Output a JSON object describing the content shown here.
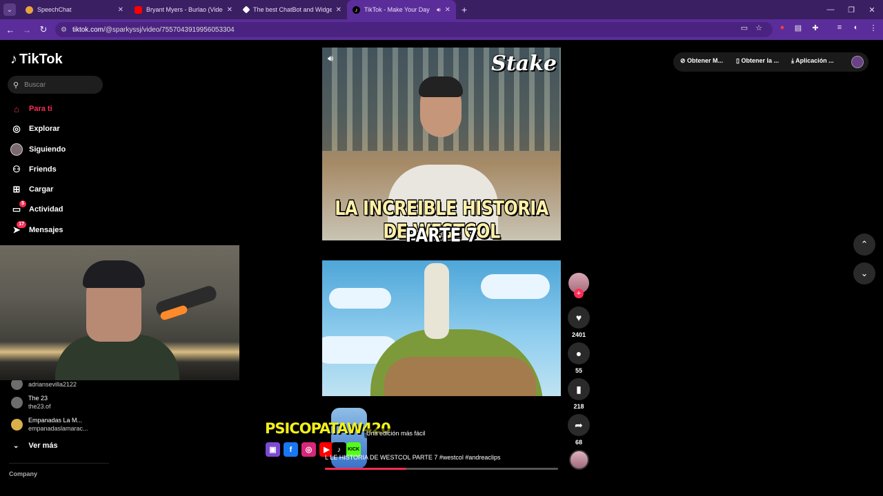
{
  "browser": {
    "tabs": [
      {
        "title": "SpeechChat",
        "icon": "speechchat-icon",
        "color": "#e8a33b"
      },
      {
        "title": "Bryant Myers - Burlao (Video Oficial)",
        "icon": "youtube-icon",
        "color": "#ff0000"
      },
      {
        "title": "The best ChatBot and Widgets",
        "icon": "streamelements-icon",
        "color": "#ffffff"
      },
      {
        "title": "TikTok - Make Your Day",
        "icon": "tiktok-icon",
        "color": "#000000"
      }
    ],
    "url_host": "tiktok.com",
    "url_path": "/@sparkyssj/video/7557043919956053304"
  },
  "sidebar": {
    "logo": "TikTok",
    "search_placeholder": "Buscar",
    "items": [
      {
        "label": "Para ti",
        "icon": "home-icon"
      },
      {
        "label": "Explorar",
        "icon": "compass-icon"
      },
      {
        "label": "Siguiendo",
        "icon": "following-avatar-icon"
      },
      {
        "label": "Friends",
        "icon": "friends-icon"
      },
      {
        "label": "Cargar",
        "icon": "upload-icon"
      },
      {
        "label": "Actividad",
        "icon": "activity-icon",
        "badge": "5"
      },
      {
        "label": "Mensajes",
        "icon": "messages-icon",
        "badge": "17"
      }
    ],
    "following": [
      {
        "name": "",
        "user": "adriansevilla2122"
      },
      {
        "name": "The 23",
        "user": "the23.of"
      },
      {
        "name": "Empanadas La M...",
        "user": "empanadaslamarac..."
      }
    ],
    "more_label": "Ver más",
    "company_label": "Company"
  },
  "video": {
    "brand": "Stake",
    "title_line1": "LA INCREIBLE HISTORIA DE WESTCOL",
    "title_line2": "PARTE 7",
    "caption": "LE HISTORIA DE WESTCOL PARTE 7 #westcol #andreaclips",
    "caption_prefix": "L",
    "hint": "Una edición más fácil",
    "progress": 0.35
  },
  "overlay": {
    "streamer": "PSICOPATAW420",
    "socials": [
      "twitch",
      "facebook",
      "instagram",
      "youtube",
      "tiktok",
      "kick"
    ],
    "kick_label": "KICK"
  },
  "actions": {
    "likes": "2401",
    "comments": "55",
    "saves": "218",
    "shares": "68"
  },
  "topbar": {
    "item1": "Obtener M...",
    "item2": "Obtener la ...",
    "item3": "Aplicación ..."
  }
}
